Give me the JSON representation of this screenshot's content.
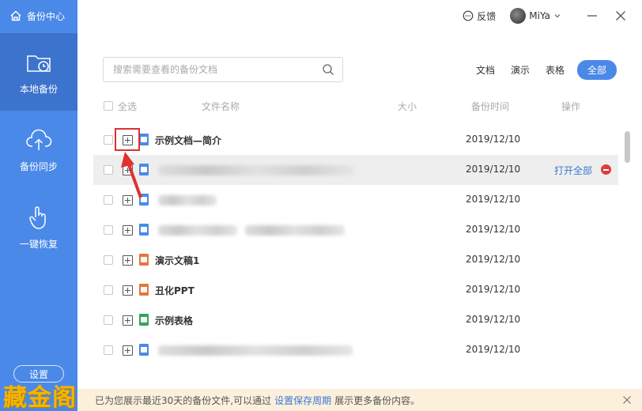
{
  "sidebar": {
    "brand": "备份中心",
    "items": [
      {
        "label": "本地备份",
        "icon": "folder-clock-icon",
        "active": true
      },
      {
        "label": "备份同步",
        "icon": "cloud-upload-icon",
        "active": false
      },
      {
        "label": "一键恢复",
        "icon": "hand-tap-icon",
        "active": false
      }
    ],
    "settings_label": "设置",
    "watermark": "藏金阁"
  },
  "topbar": {
    "feedback_label": "反馈",
    "user_name": "MiYa"
  },
  "search": {
    "placeholder": "搜索需要查看的备份文档"
  },
  "filters": [
    {
      "label": "文档",
      "active": false
    },
    {
      "label": "演示",
      "active": false
    },
    {
      "label": "表格",
      "active": false
    },
    {
      "label": "全部",
      "active": true
    }
  ],
  "table": {
    "columns": {
      "select_all": "全选",
      "name": "文件名称",
      "size": "大小",
      "time": "备份时间",
      "action": "操作"
    },
    "rows": [
      {
        "name": "示例文档—简介",
        "type": "doc",
        "date": "2019/12/10",
        "action": ""
      },
      {
        "name": "",
        "type": "doc",
        "date": "2019/12/10",
        "action": "打开全部"
      },
      {
        "name": "",
        "type": "doc",
        "date": "2019/12/10",
        "action": ""
      },
      {
        "name": "",
        "type": "doc",
        "date": "2019/12/10",
        "action": ""
      },
      {
        "name": "演示文稿1",
        "type": "ppt",
        "date": "2019/12/10",
        "action": ""
      },
      {
        "name": "丑化PPT",
        "type": "ppt",
        "date": "2019/12/10",
        "action": ""
      },
      {
        "name": "示例表格",
        "type": "xls",
        "date": "2019/12/10",
        "action": ""
      },
      {
        "name": "",
        "type": "doc",
        "date": "2019/12/10",
        "action": ""
      }
    ]
  },
  "footer": {
    "text_before": "已为您展示最近30天的备份文件,可以通过",
    "link": "设置保存周期",
    "text_after": "展示更多备份内容。"
  }
}
